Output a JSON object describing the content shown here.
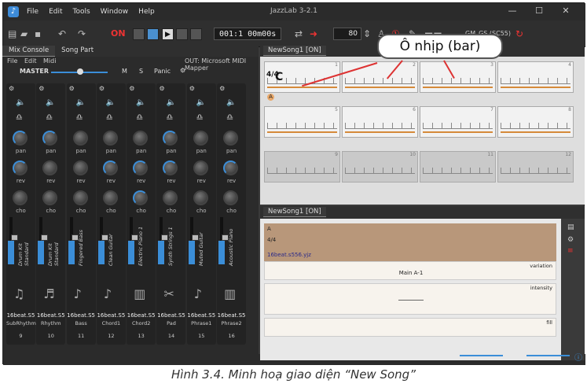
{
  "app": {
    "title": "JazzLab 3-2.1",
    "menu": [
      "File",
      "Edit",
      "Tools",
      "Window",
      "Help"
    ]
  },
  "toolbar": {
    "power": "ON",
    "counter": "001:1   00m00s",
    "tempo": "80",
    "soundfont": "GM_GS (SC55)"
  },
  "left_panel": {
    "tabs": [
      "Mix Console",
      "Song Part"
    ],
    "submenu": [
      "File",
      "Edit",
      "Midi"
    ],
    "output": "OUT: Microsoft MIDI Mapper",
    "master": "MASTER",
    "m": "M",
    "s": "S",
    "panic": "Panic",
    "knob_labels": {
      "pan": "pan",
      "rev": "rev",
      "cho": "cho"
    },
    "channels": [
      {
        "instrument": "Drum Kit Standard",
        "style": "16beat.S5",
        "part": "SubRhythm",
        "num": "9",
        "icon": "drum-icon"
      },
      {
        "instrument": "Drum Kit Standard",
        "style": "16beat.S5",
        "part": "Rhythm",
        "num": "10",
        "icon": "drumkit-icon"
      },
      {
        "instrument": "Fingered Bass",
        "style": "16beat.S5",
        "part": "Bass",
        "num": "11",
        "icon": "bass-icon"
      },
      {
        "instrument": "Clean Guitar",
        "style": "16beat.S5",
        "part": "Chord1",
        "num": "12",
        "icon": "guitar-icon"
      },
      {
        "instrument": "Electric Piano 1",
        "style": "16beat.S5",
        "part": "Chord2",
        "num": "13",
        "icon": "keyboard-icon"
      },
      {
        "instrument": "Synth Strings 1",
        "style": "16beat.S5",
        "part": "Pad",
        "num": "14",
        "icon": "strings-icon"
      },
      {
        "instrument": "Muted Guitar",
        "style": "16beat.S5",
        "part": "Phrase1",
        "num": "15",
        "icon": "guitar-icon"
      },
      {
        "instrument": "Acoustic Piano",
        "style": "16beat.S5",
        "part": "Phrase2",
        "num": "16",
        "icon": "piano-icon"
      }
    ]
  },
  "song": {
    "tab": "NewSong1 [ON]",
    "time_sig": "4/4",
    "key": "C",
    "marker": "A",
    "bar_numbers": [
      "1",
      "2",
      "3",
      "4",
      "5",
      "6",
      "7",
      "8",
      "9",
      "10",
      "11",
      "12"
    ],
    "callout": "Ô nhịp (bar)"
  },
  "song_part": {
    "tab": "NewSong1 [ON]",
    "part": "A",
    "time_sig": "4/4",
    "style_file": "16beat.s556.yjz",
    "variation_label": "variation",
    "variation_value": "Main A-1",
    "intensity_label": "intensity",
    "fill_label": "fill"
  },
  "caption": "Hình 3.4. Minh hoạ giao diện “New Song”"
}
